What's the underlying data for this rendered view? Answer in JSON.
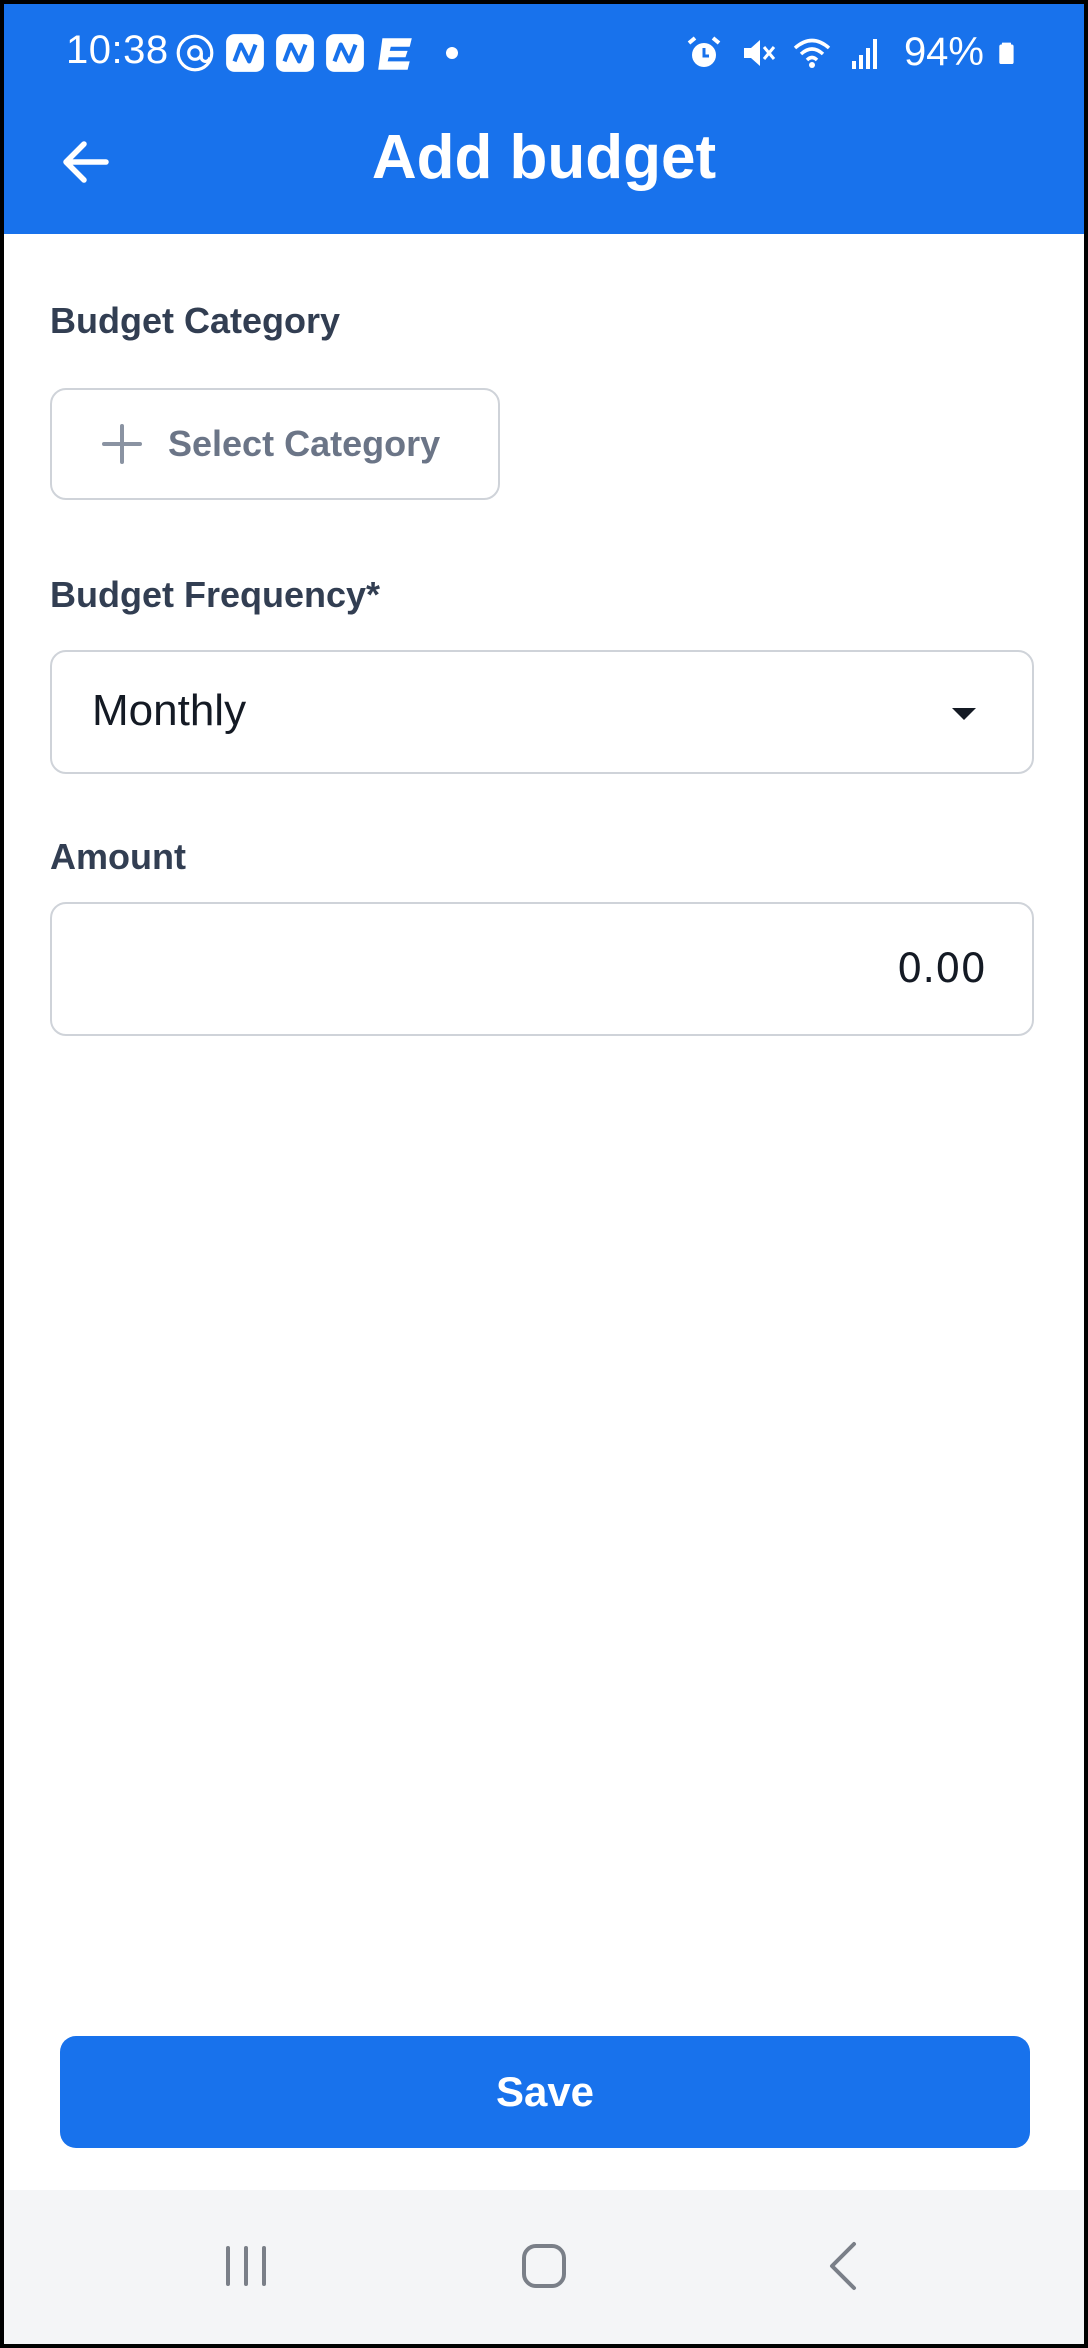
{
  "status_bar": {
    "time": "10:38",
    "battery": "94%",
    "notification_icons": [
      "threads-icon",
      "app-n-icon",
      "app-n-icon",
      "app-n-icon",
      "app-e-icon",
      "dot-icon"
    ],
    "system_icons": [
      "alarm-icon",
      "mute-icon",
      "wifi-icon",
      "signal-icon",
      "battery-icon"
    ]
  },
  "app_bar": {
    "title": "Add budget"
  },
  "form": {
    "category_label": "Budget Category",
    "select_category": "Select Category",
    "frequency_label": "Budget Frequency*",
    "frequency_value": "Monthly",
    "amount_label": "Amount",
    "amount_placeholder": "0.00"
  },
  "actions": {
    "save_label": "Save"
  },
  "colors": {
    "primary": "#1872EC",
    "label_text": "#323e52",
    "muted_text": "#6b7587",
    "border": "#cfd3d9"
  }
}
